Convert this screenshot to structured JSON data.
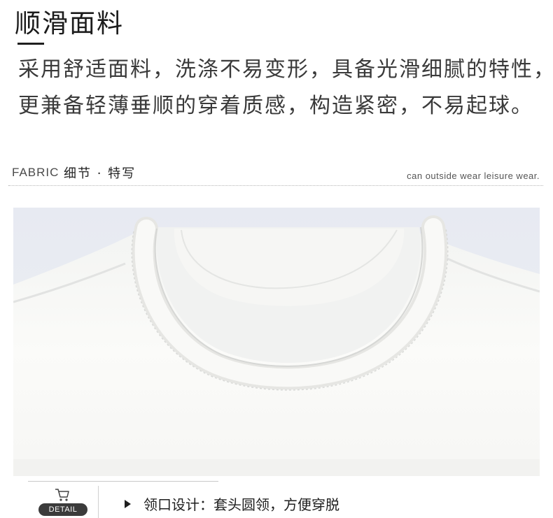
{
  "header": {
    "title": "顺滑面料",
    "description_line1": "采用舒适面料，洗涤不易变形，具备光滑细腻的特性，",
    "description_line2": "更兼备轻薄垂顺的穿着质感，构造紧密，不易起球。"
  },
  "section": {
    "label_en": "FABRIC",
    "label_cn": "细节 · 特写",
    "tagline": "can outside wear leisure wear."
  },
  "photo": {
    "subject": "white t-shirt crew neck collar close-up",
    "colors": {
      "background": "#e9ecf3",
      "fabric": "#fbfbf8",
      "shadow": "#e3e5e8"
    }
  },
  "footer": {
    "icon": "cart-icon",
    "badge": "DETAIL",
    "feature_text": "领口设计：套头圆领，方便穿脱"
  }
}
